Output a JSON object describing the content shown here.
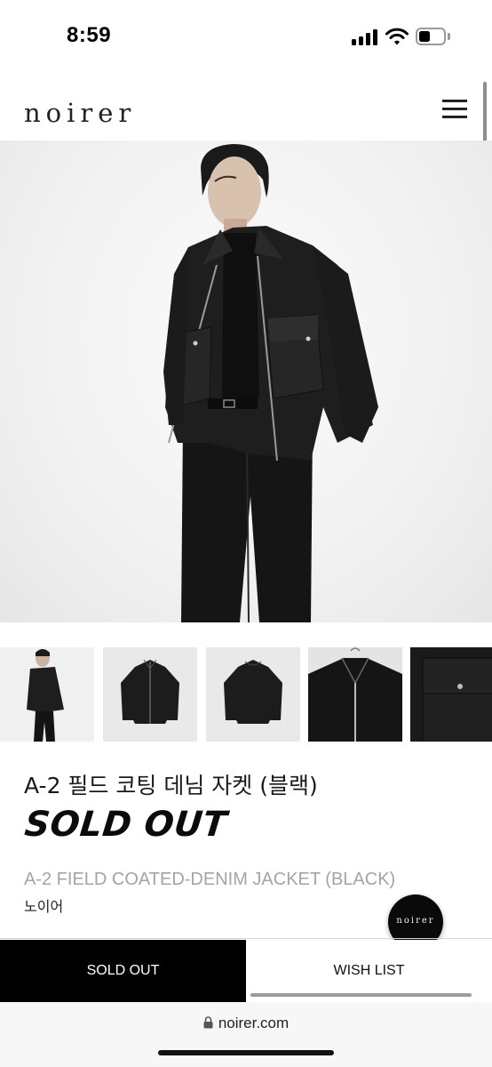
{
  "status_bar": {
    "time": "8:59",
    "battery_level": 0.3
  },
  "header": {
    "logo": "noirer",
    "menu_icon": "hamburger-menu-icon"
  },
  "product": {
    "title_ko": "A-2 필드 코팅 데님 자켓 (블랙)",
    "status": "SOLD OUT",
    "title_en": "A-2 FIELD COATED-DENIM JACKET (BLACK)",
    "brand": "노이어"
  },
  "gallery": {
    "thumbnails": [
      "model-front",
      "jacket-flat-front",
      "jacket-flat-back",
      "jacket-collar-closeup",
      "jacket-pocket-closeup"
    ]
  },
  "floating_button": {
    "label": "noirer"
  },
  "actions": {
    "sold_out_label": "SOLD OUT",
    "wishlist_label": "WISH LIST"
  },
  "browser": {
    "url": "noirer.com"
  },
  "colors": {
    "primary": "#000000",
    "muted_text": "#a4a4a4",
    "background": "#ffffff"
  }
}
